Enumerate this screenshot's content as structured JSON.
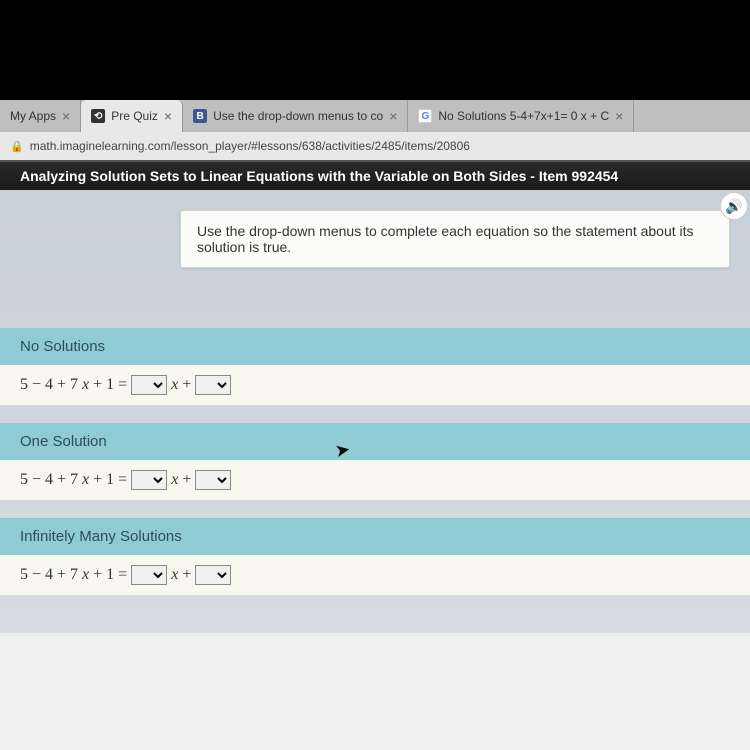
{
  "tabs": [
    {
      "label": "My Apps",
      "close": "×"
    },
    {
      "label": "Pre Quiz",
      "close": "×"
    },
    {
      "label": "Use the drop-down menus to co",
      "close": "×"
    },
    {
      "label": "No Solutions 5-4+7x+1= 0 x + C",
      "close": "×"
    }
  ],
  "address": "math.imaginelearning.com/lesson_player/#lessons/638/activities/2485/items/20806",
  "lesson_title": "Analyzing Solution Sets to Linear Equations with the Variable on Both Sides - Item 992454",
  "instruction": "Use the drop-down menus to complete each equation so the statement about its solution is true.",
  "questions": [
    {
      "header": "No Solutions",
      "lhs_a": "5 − 4 + 7",
      "lhs_b": " + 1 =",
      "mid": " +"
    },
    {
      "header": "One Solution",
      "lhs_a": "5 − 4 + 7",
      "lhs_b": " + 1 =",
      "mid": " +"
    },
    {
      "header": "Infinitely Many Solutions",
      "lhs_a": "5 − 4 + 7",
      "lhs_b": " + 1 =",
      "mid": " +"
    }
  ],
  "var_x": "x",
  "audio_icon": "🔊"
}
